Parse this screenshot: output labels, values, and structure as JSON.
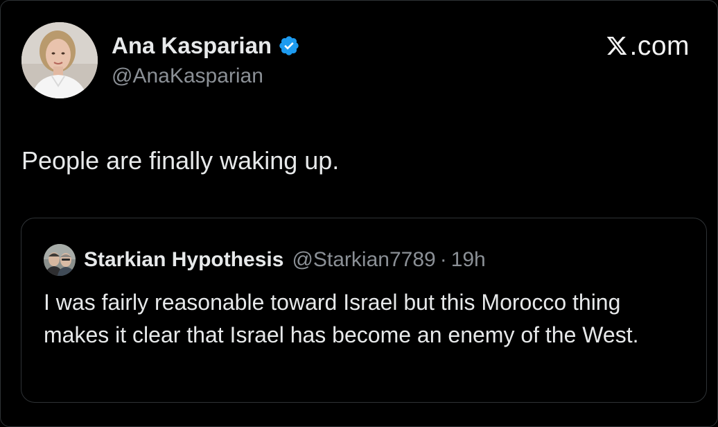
{
  "author": {
    "display_name": "Ana Kasparian",
    "handle": "@AnaKasparian",
    "verified": true,
    "avatar_icon": "profile-photo"
  },
  "brand": {
    "label": ".com",
    "logo_icon": "x-logo-icon"
  },
  "tweet": {
    "text": "People are finally waking up."
  },
  "quoted_tweet": {
    "display_name": "Starkian Hypothesis",
    "handle": "@Starkian7789",
    "separator": "·",
    "time": "19h",
    "text": "I was fairly reasonable toward Israel but this Morocco thing makes it clear that Israel has become an enemy of the West.",
    "avatar_icon": "profile-photo"
  },
  "colors": {
    "background": "#000000",
    "text_primary": "#e7e9ea",
    "text_secondary": "#8b9096",
    "border": "#2f3336",
    "verified_blue": "#1d9bf0"
  }
}
